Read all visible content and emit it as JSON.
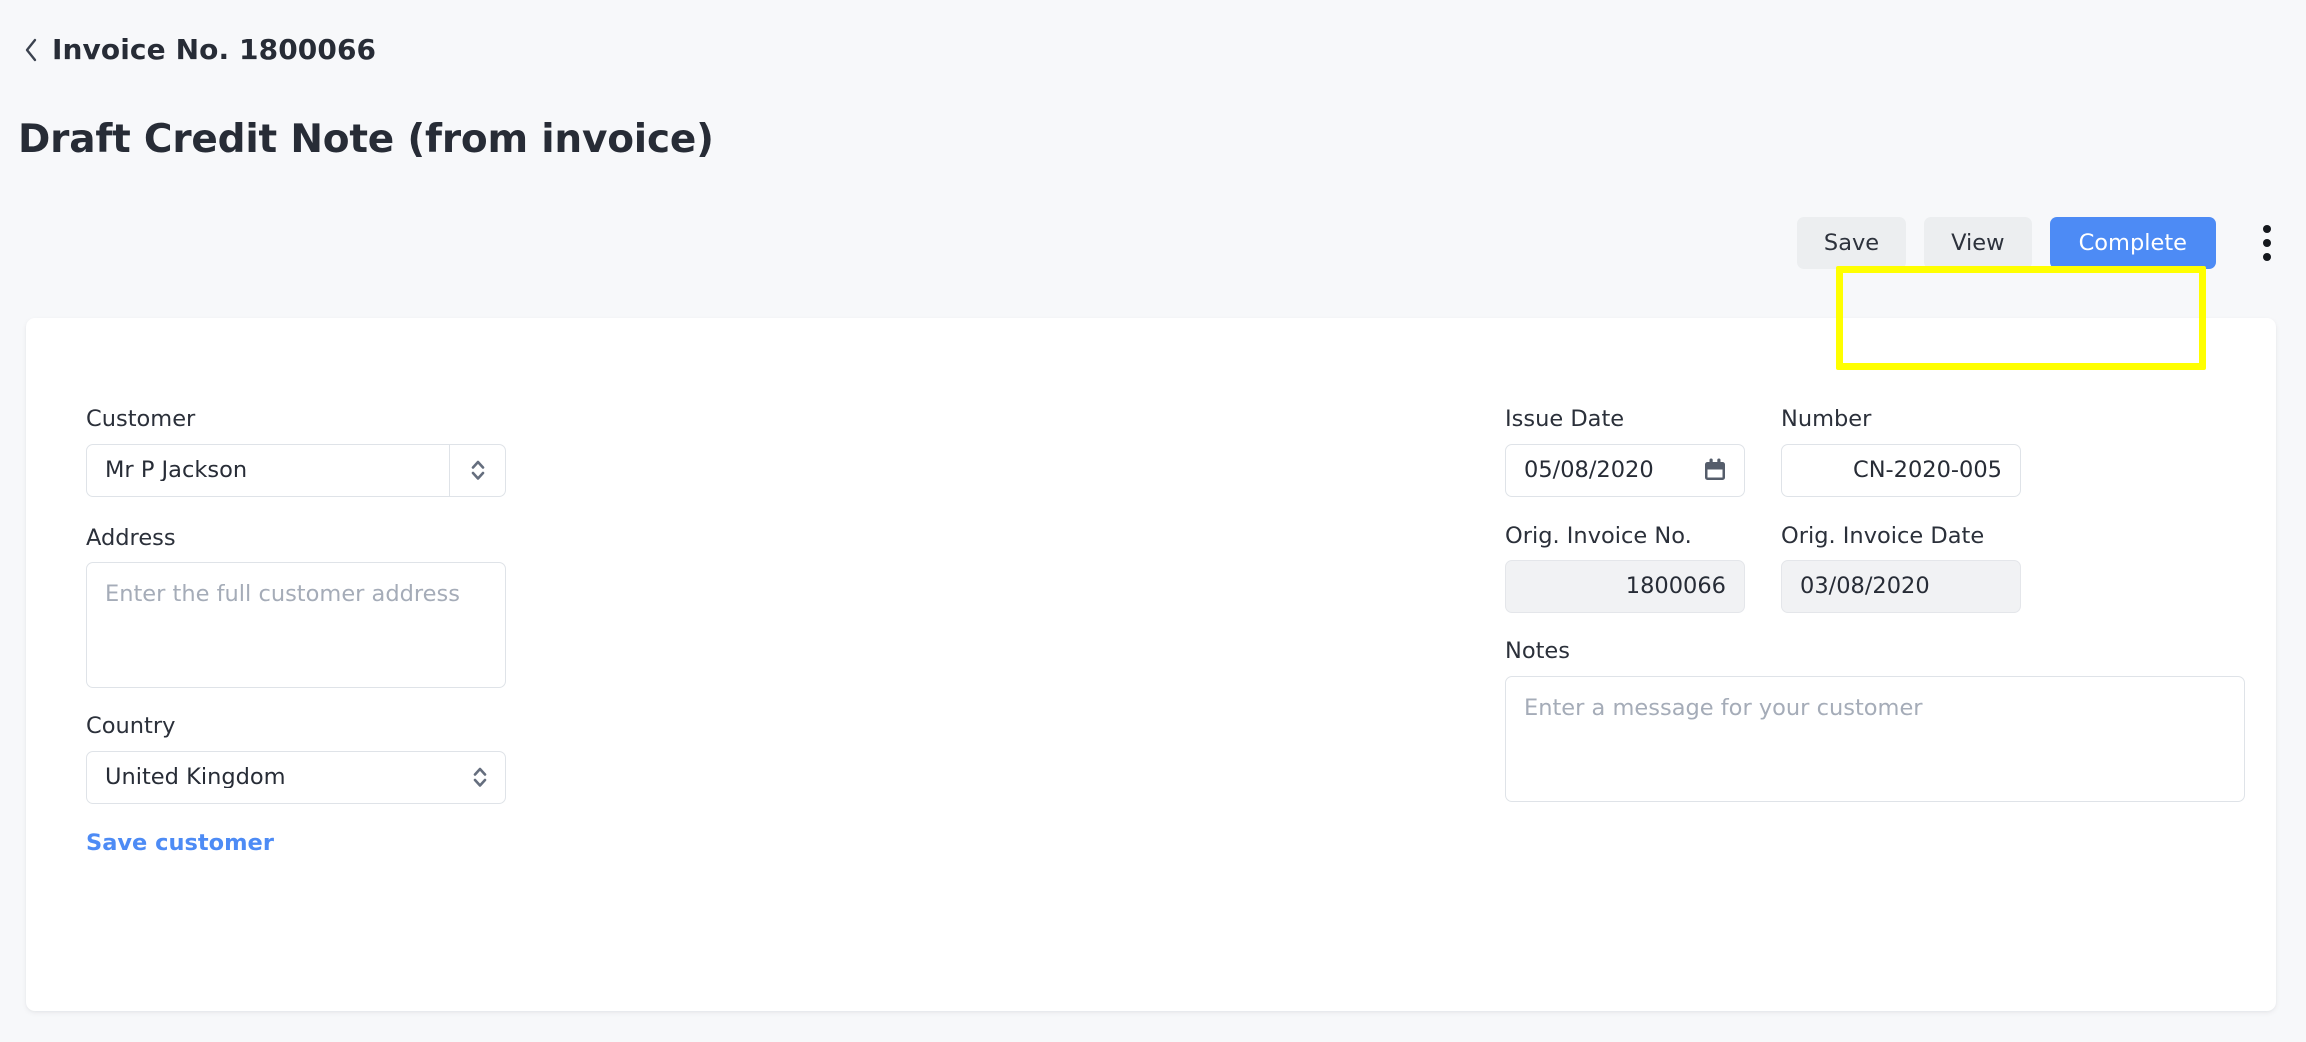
{
  "breadcrumb": {
    "back_icon": "chevron-left-icon",
    "label": "Invoice No. 1800066"
  },
  "page_title": "Draft Credit Note (from invoice)",
  "toolbar": {
    "save_label": "Save",
    "view_label": "View",
    "complete_label": "Complete",
    "overflow_icon": "kebab-menu-icon",
    "primary_color": "#4d8bf5",
    "secondary_color": "#eceef0"
  },
  "form": {
    "customer": {
      "label": "Customer",
      "value": "Mr P Jackson",
      "stepper_icon": "chevron-up-down-icon"
    },
    "address": {
      "label": "Address",
      "value": "",
      "placeholder": "Enter the full customer address"
    },
    "country": {
      "label": "Country",
      "value": "United Kingdom",
      "stepper_icon": "chevron-up-down-icon"
    },
    "save_customer_link": "Save customer",
    "issue_date": {
      "label": "Issue Date",
      "value": "05/08/2020",
      "icon": "calendar-icon"
    },
    "number": {
      "label": "Number",
      "value": "CN-2020-005",
      "highlight_color": "#ffff00"
    },
    "orig_invoice_no": {
      "label": "Orig. Invoice No.",
      "value": "1800066",
      "disabled": true
    },
    "orig_invoice_date": {
      "label": "Orig. Invoice Date",
      "value": "03/08/2020",
      "disabled": true
    },
    "notes": {
      "label": "Notes",
      "value": "",
      "placeholder": "Enter a message for your customer"
    }
  }
}
